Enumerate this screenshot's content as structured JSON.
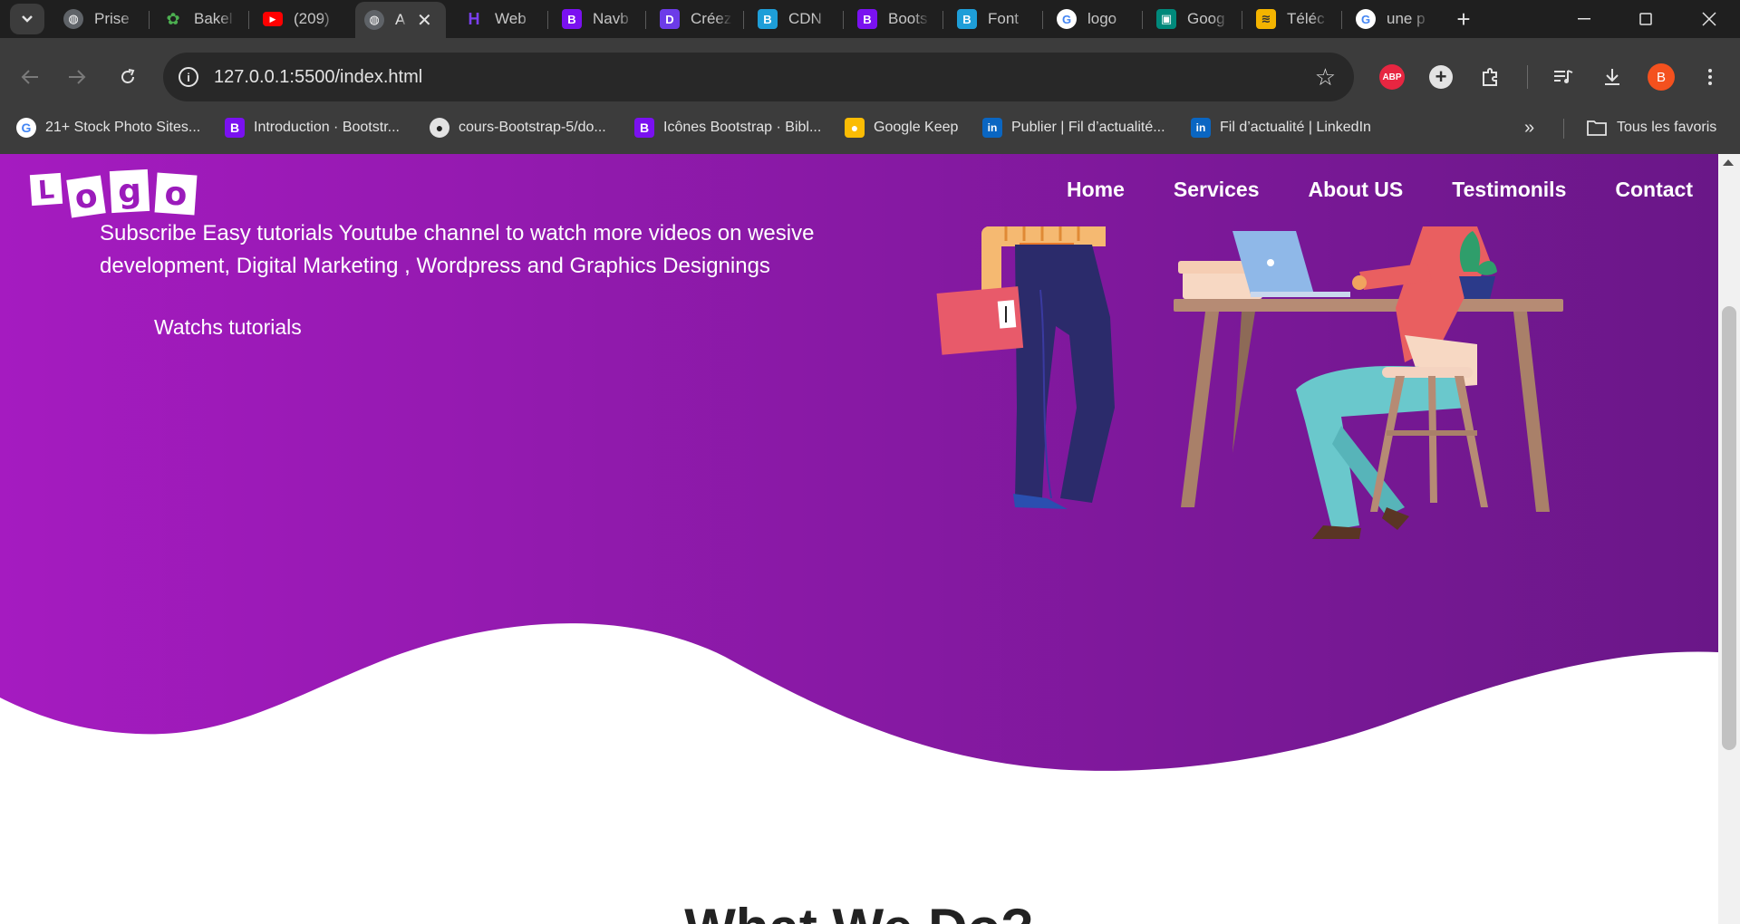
{
  "browser": {
    "tabs": [
      {
        "title": "Prise",
        "icon": "globe-icon",
        "color": "#5f6368"
      },
      {
        "title": "Bakel",
        "icon": "bakeli-icon",
        "color": "#1f1f1f"
      },
      {
        "title": "(209)",
        "icon": "youtube-icon",
        "color": "#ff0000"
      },
      {
        "title": "A",
        "icon": "globe-icon",
        "color": "#5f6368",
        "active": true
      },
      {
        "title": "Web",
        "icon": "h-icon",
        "color": "#7b3ff2"
      },
      {
        "title": "Navb",
        "icon": "bootstrap-icon",
        "color": "#7a11f0"
      },
      {
        "title": "Créez",
        "icon": "d-icon",
        "color": "#6c3be8"
      },
      {
        "title": "CDN",
        "icon": "b-icon",
        "color": "#1e9ed8"
      },
      {
        "title": "Boots",
        "icon": "bootstrap-icon",
        "color": "#7a11f0"
      },
      {
        "title": "Font",
        "icon": "b-icon",
        "color": "#1e9ed8"
      },
      {
        "title": "logo",
        "icon": "google-icon",
        "color": "#ffffff"
      },
      {
        "title": "Goog",
        "icon": "meet-icon",
        "color": "#00897b"
      },
      {
        "title": "Téléc",
        "icon": "layers-icon",
        "color": "#f4b400"
      },
      {
        "title": "une p",
        "icon": "google-icon",
        "color": "#ffffff"
      }
    ],
    "url": "127.0.0.1:5500/index.html",
    "extensions": {
      "abp": "ABP",
      "avatar": "B"
    },
    "bookmarks": [
      {
        "label": "21+ Stock Photo Sites...",
        "icon": "google-icon"
      },
      {
        "label": "Introduction · Bootstr...",
        "icon": "bootstrap-icon"
      },
      {
        "label": "cours-Bootstrap-5/do...",
        "icon": "github-icon"
      },
      {
        "label": "Icônes Bootstrap · Bibl...",
        "icon": "bootstrap-icon"
      },
      {
        "label": "Google Keep",
        "icon": "keep-icon"
      },
      {
        "label": "Publier | Fil d’actualité...",
        "icon": "linkedin-icon"
      },
      {
        "label": "Fil d’actualité | LinkedIn",
        "icon": "linkedin-icon"
      }
    ],
    "all_bookmarks": "Tous les favoris"
  },
  "page": {
    "logo_letters": [
      "L",
      "o",
      "g",
      "o"
    ],
    "nav": [
      "Home",
      "Services",
      "About US",
      "Testimonils",
      "Contact"
    ],
    "hero_text": "Subscribe Easy tutorials Youtube channel to watch more videos on wesive development, Digital Marketing , Wordpress and Graphics Designings",
    "hero_button": "Watchs tutorials",
    "section_title": "What We Do?",
    "colors": {
      "gradient_start": "#a51bc0",
      "gradient_end": "#6a1788"
    }
  }
}
